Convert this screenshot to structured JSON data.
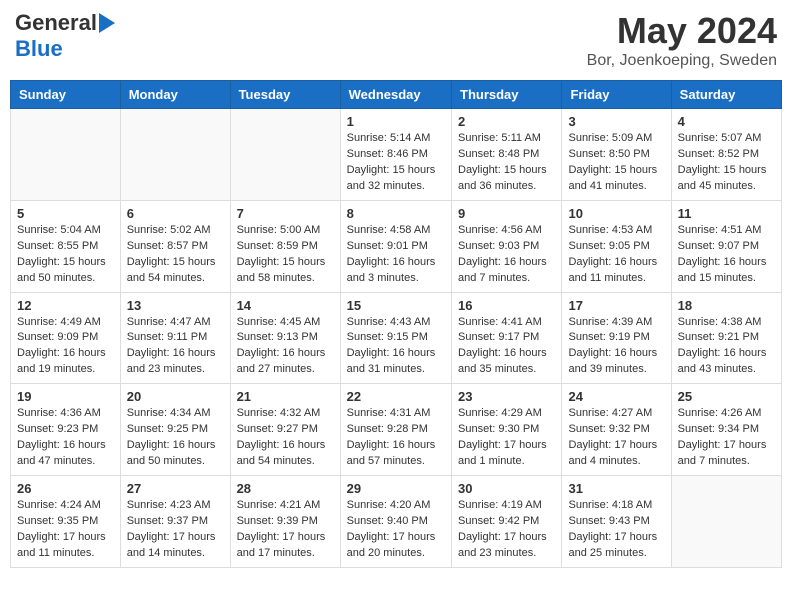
{
  "header": {
    "logo_general": "General",
    "logo_blue": "Blue",
    "month": "May 2024",
    "location": "Bor, Joenkoeping, Sweden"
  },
  "days_of_week": [
    "Sunday",
    "Monday",
    "Tuesday",
    "Wednesday",
    "Thursday",
    "Friday",
    "Saturday"
  ],
  "weeks": [
    [
      {
        "day": "",
        "info": ""
      },
      {
        "day": "",
        "info": ""
      },
      {
        "day": "",
        "info": ""
      },
      {
        "day": "1",
        "info": "Sunrise: 5:14 AM\nSunset: 8:46 PM\nDaylight: 15 hours\nand 32 minutes."
      },
      {
        "day": "2",
        "info": "Sunrise: 5:11 AM\nSunset: 8:48 PM\nDaylight: 15 hours\nand 36 minutes."
      },
      {
        "day": "3",
        "info": "Sunrise: 5:09 AM\nSunset: 8:50 PM\nDaylight: 15 hours\nand 41 minutes."
      },
      {
        "day": "4",
        "info": "Sunrise: 5:07 AM\nSunset: 8:52 PM\nDaylight: 15 hours\nand 45 minutes."
      }
    ],
    [
      {
        "day": "5",
        "info": "Sunrise: 5:04 AM\nSunset: 8:55 PM\nDaylight: 15 hours\nand 50 minutes."
      },
      {
        "day": "6",
        "info": "Sunrise: 5:02 AM\nSunset: 8:57 PM\nDaylight: 15 hours\nand 54 minutes."
      },
      {
        "day": "7",
        "info": "Sunrise: 5:00 AM\nSunset: 8:59 PM\nDaylight: 15 hours\nand 58 minutes."
      },
      {
        "day": "8",
        "info": "Sunrise: 4:58 AM\nSunset: 9:01 PM\nDaylight: 16 hours\nand 3 minutes."
      },
      {
        "day": "9",
        "info": "Sunrise: 4:56 AM\nSunset: 9:03 PM\nDaylight: 16 hours\nand 7 minutes."
      },
      {
        "day": "10",
        "info": "Sunrise: 4:53 AM\nSunset: 9:05 PM\nDaylight: 16 hours\nand 11 minutes."
      },
      {
        "day": "11",
        "info": "Sunrise: 4:51 AM\nSunset: 9:07 PM\nDaylight: 16 hours\nand 15 minutes."
      }
    ],
    [
      {
        "day": "12",
        "info": "Sunrise: 4:49 AM\nSunset: 9:09 PM\nDaylight: 16 hours\nand 19 minutes."
      },
      {
        "day": "13",
        "info": "Sunrise: 4:47 AM\nSunset: 9:11 PM\nDaylight: 16 hours\nand 23 minutes."
      },
      {
        "day": "14",
        "info": "Sunrise: 4:45 AM\nSunset: 9:13 PM\nDaylight: 16 hours\nand 27 minutes."
      },
      {
        "day": "15",
        "info": "Sunrise: 4:43 AM\nSunset: 9:15 PM\nDaylight: 16 hours\nand 31 minutes."
      },
      {
        "day": "16",
        "info": "Sunrise: 4:41 AM\nSunset: 9:17 PM\nDaylight: 16 hours\nand 35 minutes."
      },
      {
        "day": "17",
        "info": "Sunrise: 4:39 AM\nSunset: 9:19 PM\nDaylight: 16 hours\nand 39 minutes."
      },
      {
        "day": "18",
        "info": "Sunrise: 4:38 AM\nSunset: 9:21 PM\nDaylight: 16 hours\nand 43 minutes."
      }
    ],
    [
      {
        "day": "19",
        "info": "Sunrise: 4:36 AM\nSunset: 9:23 PM\nDaylight: 16 hours\nand 47 minutes."
      },
      {
        "day": "20",
        "info": "Sunrise: 4:34 AM\nSunset: 9:25 PM\nDaylight: 16 hours\nand 50 minutes."
      },
      {
        "day": "21",
        "info": "Sunrise: 4:32 AM\nSunset: 9:27 PM\nDaylight: 16 hours\nand 54 minutes."
      },
      {
        "day": "22",
        "info": "Sunrise: 4:31 AM\nSunset: 9:28 PM\nDaylight: 16 hours\nand 57 minutes."
      },
      {
        "day": "23",
        "info": "Sunrise: 4:29 AM\nSunset: 9:30 PM\nDaylight: 17 hours\nand 1 minute."
      },
      {
        "day": "24",
        "info": "Sunrise: 4:27 AM\nSunset: 9:32 PM\nDaylight: 17 hours\nand 4 minutes."
      },
      {
        "day": "25",
        "info": "Sunrise: 4:26 AM\nSunset: 9:34 PM\nDaylight: 17 hours\nand 7 minutes."
      }
    ],
    [
      {
        "day": "26",
        "info": "Sunrise: 4:24 AM\nSunset: 9:35 PM\nDaylight: 17 hours\nand 11 minutes."
      },
      {
        "day": "27",
        "info": "Sunrise: 4:23 AM\nSunset: 9:37 PM\nDaylight: 17 hours\nand 14 minutes."
      },
      {
        "day": "28",
        "info": "Sunrise: 4:21 AM\nSunset: 9:39 PM\nDaylight: 17 hours\nand 17 minutes."
      },
      {
        "day": "29",
        "info": "Sunrise: 4:20 AM\nSunset: 9:40 PM\nDaylight: 17 hours\nand 20 minutes."
      },
      {
        "day": "30",
        "info": "Sunrise: 4:19 AM\nSunset: 9:42 PM\nDaylight: 17 hours\nand 23 minutes."
      },
      {
        "day": "31",
        "info": "Sunrise: 4:18 AM\nSunset: 9:43 PM\nDaylight: 17 hours\nand 25 minutes."
      },
      {
        "day": "",
        "info": ""
      }
    ]
  ]
}
